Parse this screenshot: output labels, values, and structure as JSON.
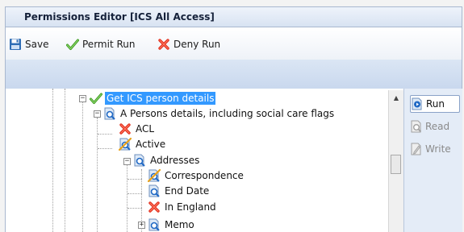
{
  "window": {
    "title": "Permissions Editor [ICS All Access]"
  },
  "toolbar": {
    "save_label": "Save",
    "permit_run_label": "Permit Run",
    "deny_run_label": "Deny Run"
  },
  "tree": {
    "nodes": [
      {
        "label": "Get ICS person details",
        "icon": "green-check-icon",
        "expanded": true,
        "selected": true
      },
      {
        "label": "A Persons details, including social care flags",
        "icon": "magnifier-icon",
        "expanded": true
      },
      {
        "label": "ACL",
        "icon": "red-x-icon"
      },
      {
        "label": "Active",
        "icon": "partial-magnifier-icon"
      },
      {
        "label": "Addresses",
        "icon": "magnifier-icon",
        "expanded": true
      },
      {
        "label": "Correspondence",
        "icon": "partial-magnifier-icon"
      },
      {
        "label": "End Date",
        "icon": "magnifier-icon"
      },
      {
        "label": "In England",
        "icon": "red-x-icon"
      },
      {
        "label": "Memo",
        "icon": "magnifier-icon",
        "expanded": false
      }
    ]
  },
  "side_panel": {
    "run_label": "Run",
    "read_label": "Read",
    "write_label": "Write"
  },
  "colors": {
    "selection": "#3399ff",
    "title_text": "#15213a",
    "side_panel_bg": "#e4ecf7"
  }
}
